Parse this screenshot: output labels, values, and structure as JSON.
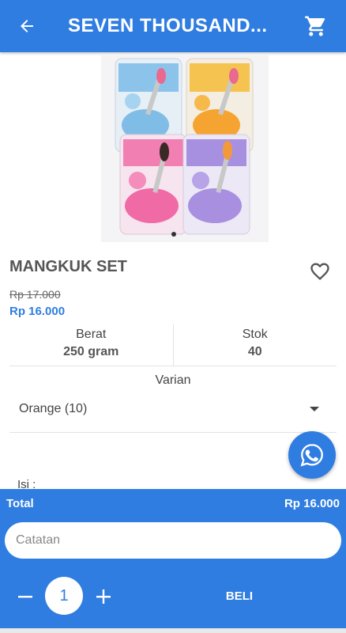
{
  "colors": {
    "primary": "#2f7de1",
    "text": "#444444",
    "white": "#ffffff"
  },
  "header": {
    "title": "SEVEN THOUSAND...",
    "back_icon": "arrow-left-icon",
    "cart_icon": "cart-icon"
  },
  "product": {
    "name": "MANGKUK SET",
    "old_price": "Rp 17.000",
    "price": "Rp 16.000",
    "favorite_icon": "heart-outline-icon"
  },
  "info": {
    "weight_label": "Berat",
    "weight_value": "250 gram",
    "stock_label": "Stok",
    "stock_value": "40"
  },
  "variant": {
    "label": "Varian",
    "selected": "Orange (10)"
  },
  "description": {
    "label": "Isi :"
  },
  "chat": {
    "icon": "whatsapp-icon"
  },
  "checkout": {
    "total_label": "Total",
    "total_value": "Rp 16.000",
    "note_placeholder": "Catatan",
    "quantity": "1",
    "buy_label": "BELI"
  }
}
